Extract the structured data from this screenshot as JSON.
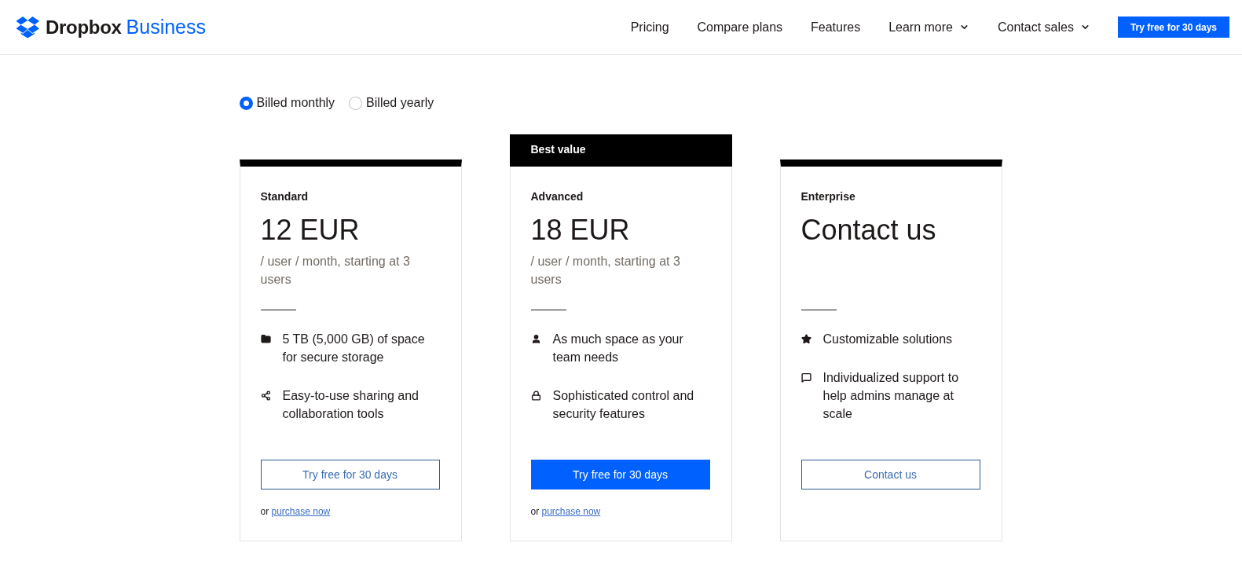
{
  "header": {
    "brand": "Dropbox",
    "product": "Business",
    "nav": [
      {
        "label": "Pricing",
        "kind": "link"
      },
      {
        "label": "Compare plans",
        "kind": "link"
      },
      {
        "label": "Features",
        "kind": "link"
      },
      {
        "label": "Learn more",
        "kind": "dropdown"
      },
      {
        "label": "Contact sales",
        "kind": "dropdown"
      }
    ],
    "cta": "Try free for 30 days"
  },
  "billing": [
    {
      "label": "Billed monthly",
      "selected": true
    },
    {
      "label": "Billed yearly",
      "selected": false
    }
  ],
  "plans": [
    {
      "name": "Standard",
      "price": "12 EUR",
      "price_note": "/ user / month, starting at 3 users",
      "features": [
        {
          "kind": "folder",
          "text": "5 TB (5,000 GB) of space for secure storage"
        },
        {
          "kind": "share",
          "text": "Easy-to-use sharing and collaboration tools"
        }
      ],
      "button": {
        "label": "Try free for 30 days",
        "kind": "outline"
      },
      "purchase": {
        "prefix": "or",
        "link": "purchase now"
      }
    },
    {
      "badge": "Best value",
      "name": "Advanced",
      "price": "18 EUR",
      "price_note": "/ user / month, starting at 3 users",
      "features": [
        {
          "kind": "person",
          "text": "As much space as your team needs"
        },
        {
          "kind": "lock",
          "text": "Sophisticated control and security features"
        }
      ],
      "button": {
        "label": "Try free for 30 days",
        "kind": "primary"
      },
      "purchase": {
        "prefix": "or",
        "link": "purchase now"
      }
    },
    {
      "name": "Enterprise",
      "price": "Contact us",
      "features": [
        {
          "kind": "star",
          "text": "Customizable solutions"
        },
        {
          "kind": "comment",
          "text": "Individualized support to help admins manage at scale"
        }
      ],
      "button": {
        "label": "Contact us",
        "kind": "outline"
      }
    }
  ]
}
